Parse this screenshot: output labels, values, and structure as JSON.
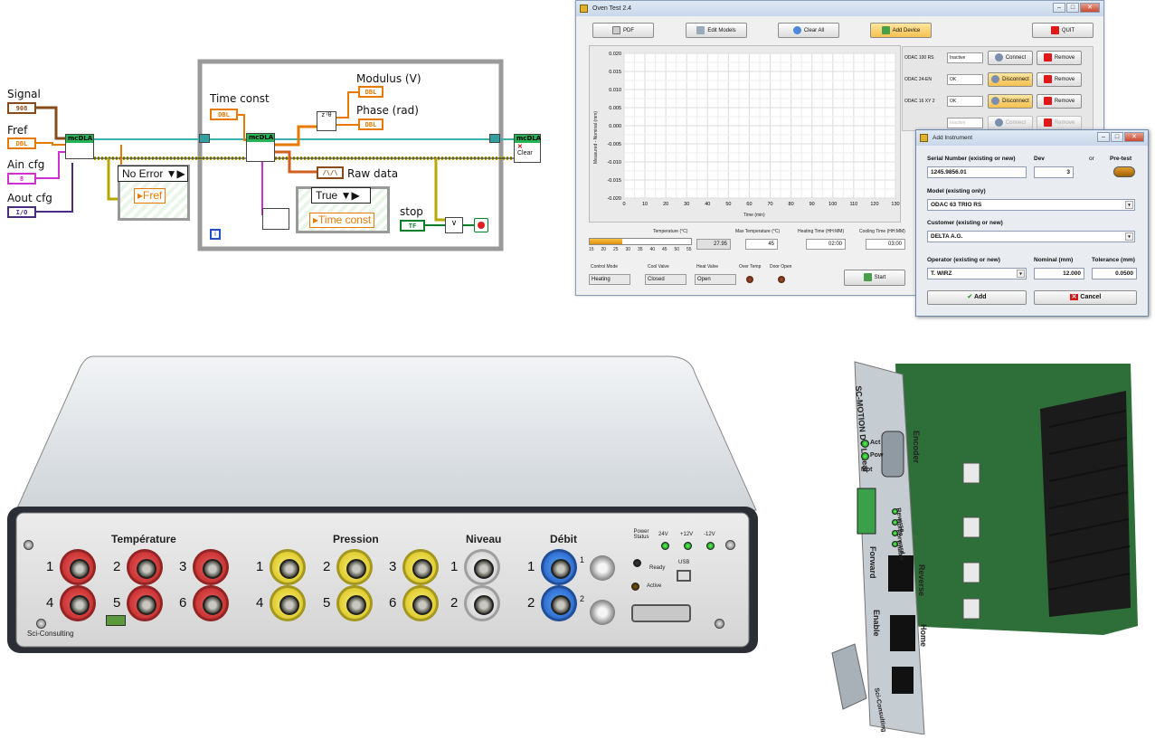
{
  "labview": {
    "inputs": [
      {
        "label": "Signal",
        "type": "908"
      },
      {
        "label": "Fref",
        "type": "DBL"
      },
      {
        "label": "Ain cfg",
        "type": "8"
      },
      {
        "label": "Aout cfg",
        "type": "I/O"
      }
    ],
    "mcdla_label": "mcDLA",
    "no_error": "No Error",
    "fref_local": "Fref",
    "time_const_label": "Time const",
    "time_const_type": "DBL",
    "modulus_label": "Modulus (V)",
    "phase_label": "Phase (rad)",
    "dbl": "DBL",
    "raw_data_label": "Raw data",
    "true_case": "True",
    "time_const_local": "Time const",
    "stop_label": "stop",
    "stop_type": "TF",
    "clear_label": "Clear",
    "info_icon": "i"
  },
  "oven": {
    "title": "Oven Test 2.4",
    "toolbar": {
      "pdf": "PDF",
      "edit_models": "Edit Models",
      "clear_all": "Clear All",
      "add_device": "Add Device",
      "quit": "QUIT"
    },
    "y_axis_label": "Measured - Nominal (mm)",
    "x_axis_label": "Time (min)",
    "y_ticks": [
      "0.020",
      "0.015",
      "0.010",
      "0.005",
      "0.000",
      "-0.005",
      "-0.010",
      "-0.015",
      "-0.020"
    ],
    "x_ticks": [
      "0",
      "10",
      "20",
      "30",
      "40",
      "50",
      "60",
      "70",
      "80",
      "90",
      "100",
      "110",
      "120",
      "130"
    ],
    "devices": [
      {
        "name": "ODAC 100 RS",
        "status": "Inactive",
        "action": "Connect",
        "remove": "Remove"
      },
      {
        "name": "ODAC 24-EN",
        "status": "OK",
        "action": "Disconnect",
        "remove": "Remove"
      },
      {
        "name": "ODAC 16 XY 2",
        "status": "OK",
        "action": "Disconnect",
        "remove": "Remove"
      },
      {
        "name": "",
        "status": "Inactive",
        "action": "Connect",
        "remove": "Remove"
      }
    ],
    "temperature_label": "Temperature (°C)",
    "temp_scale": [
      "15",
      "20",
      "25",
      "30",
      "35",
      "40",
      "45",
      "50",
      "55"
    ],
    "temp_value": "27.95",
    "temp_fill": 0.32,
    "max_temp_label": "Max Temperature (°C)",
    "max_temp_value": "45",
    "heating_time_label": "Heating Time (HH:MM)",
    "heating_time_value": "02:00",
    "cooling_time_label": "Cooling Time (HH:MM)",
    "cooling_time_value": "03:00",
    "control_mode_label": "Control Mode",
    "control_mode_value": "Heating",
    "cool_valve_label": "Cool Valve",
    "cool_valve_value": "Closed",
    "heat_valve_label": "Heat Valve",
    "heat_valve_value": "Open",
    "over_temp_label": "Over Temp",
    "door_open_label": "Door Open",
    "start": "Start"
  },
  "dialog": {
    "title": "Add Instrument",
    "serial_label": "Serial Number (existing or new)",
    "serial_value": "1245.9856.01",
    "dev_label": "Dev",
    "dev_value": "3",
    "or_label": "or",
    "pretest_label": "Pre-test",
    "model_label": "Model (existing only)",
    "model_value": "ODAC 63 TRIO RS",
    "customer_label": "Customer (existing or new)",
    "customer_value": "DELTA A.G.",
    "operator_label": "Operator (existing or new)",
    "operator_value": "T. WIRZ",
    "nominal_label": "Nominal (mm)",
    "nominal_value": "12.000",
    "tolerance_label": "Tolerance (mm)",
    "tolerance_value": "0.0500",
    "add": "Add",
    "cancel": "Cancel"
  },
  "box": {
    "temperature": "Température",
    "pression": "Pression",
    "niveau": "Niveau",
    "debit": "Débit",
    "temp_nums": [
      "1",
      "2",
      "3",
      "4",
      "5",
      "6"
    ],
    "pres_nums": [
      "1",
      "2",
      "3",
      "4",
      "5",
      "6"
    ],
    "niv_nums": [
      "1",
      "2"
    ],
    "deb_nums": [
      "1",
      "2"
    ],
    "bnc_nums": [
      "1",
      "2"
    ],
    "power_status": "Power Status",
    "v24": "24V",
    "vp12": "+12V",
    "vm12": "-12V",
    "ready": "Ready",
    "active": "Active",
    "usb": "USB",
    "brand": "Sci-Consulting"
  },
  "card": {
    "title": "SC-MOTION DC Linear",
    "encoder": "Encoder",
    "act": "Act",
    "pow": "Pow",
    "mot": "Mot",
    "leds": [
      "Reverse",
      "Home",
      "Forward",
      "Enable"
    ],
    "forward": "Forward",
    "reverse": "Reverse",
    "enable": "Enable",
    "home": "Home",
    "brand": "Sci-Consulting"
  }
}
